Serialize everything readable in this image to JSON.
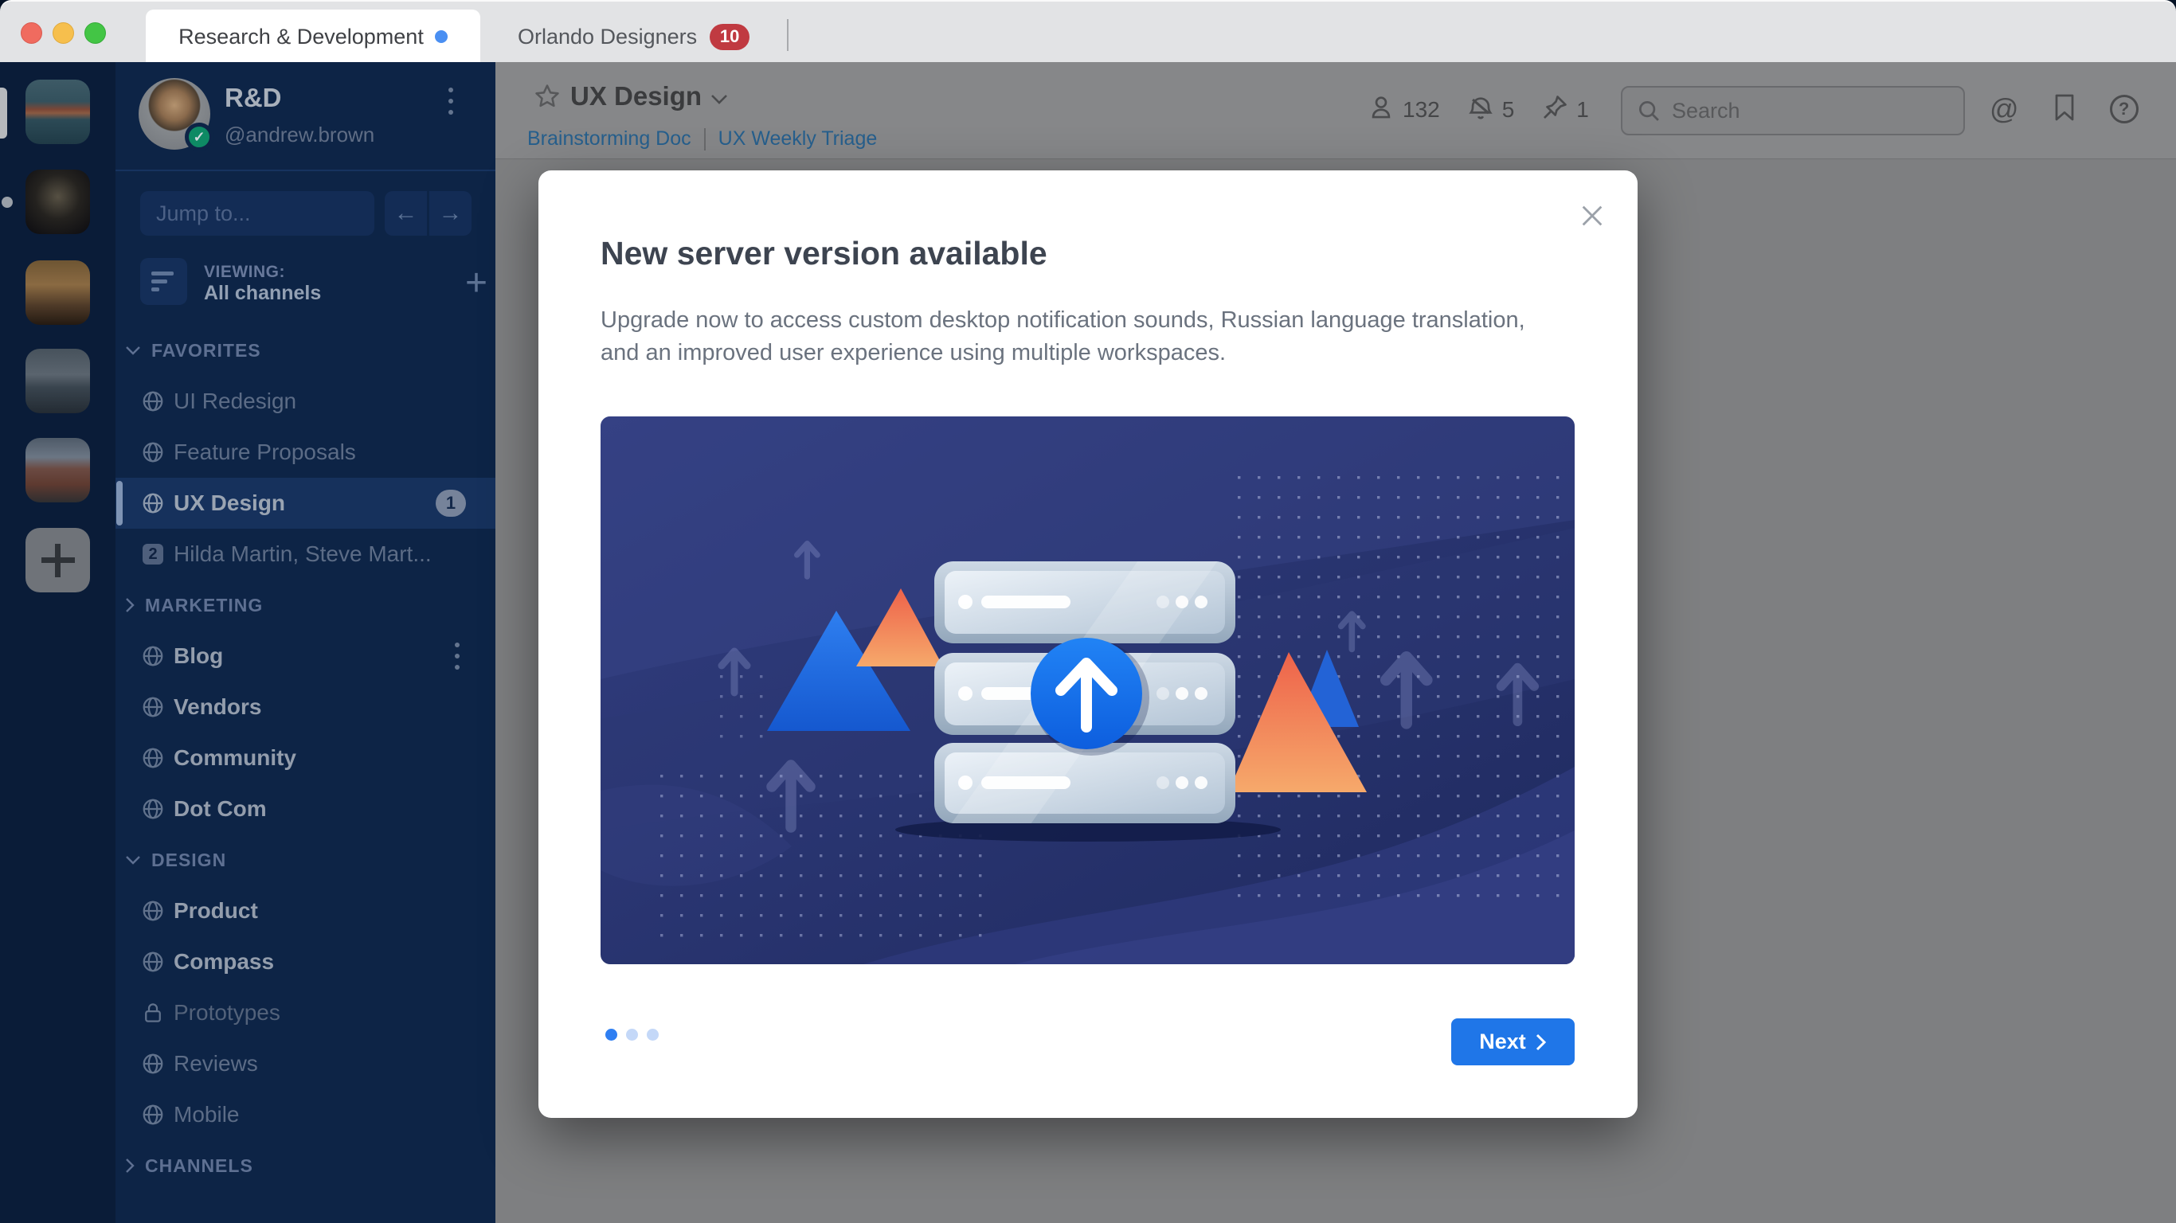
{
  "window": {
    "tabs": [
      {
        "label": "Research & Development",
        "active": true,
        "unread_dot": true
      },
      {
        "label": "Orlando Designers",
        "active": false,
        "badge": "10"
      }
    ]
  },
  "workspace_strip": {
    "avatars": [
      {
        "name": "golden-gate-workspace",
        "gradient": "linear-gradient(180deg,#3d5a66 0%,#33505c 34%,#7a4636 46%,#8a5a42 52%,#2c4a56 62%,#1f3a46 100%)"
      },
      {
        "name": "cathedral-workspace",
        "gradient": "radial-gradient(circle at 50% 42%, #565043 0%, #24221f 45%, #0b0b10 100%)"
      },
      {
        "name": "sunset-city-workspace",
        "gradient": "linear-gradient(180deg,#6e5533 0%,#8a6a42 38%,#4e3a28 70%,#241a12 100%)"
      },
      {
        "name": "city-street-workspace",
        "gradient": "linear-gradient(180deg,#47525c 0%,#5a646e 40%,#39444e 60%,#232b33 100%)"
      },
      {
        "name": "red-building-workspace",
        "gradient": "linear-gradient(180deg,#4e5a68 0%,#6b7684 30%,#6b4a42 48%,#5e3a30 72%,#2e2e30 100%)"
      }
    ],
    "add_label": "+"
  },
  "sidebar": {
    "workspace_name": "R&D",
    "user_handle": "@andrew.brown",
    "jump_placeholder": "Jump to...",
    "viewing_label": "VIEWING:",
    "viewing_value": "All channels",
    "sections": [
      {
        "label": "FAVORITES",
        "collapsed": false,
        "items": [
          {
            "label": "UI Redesign",
            "icon": "globe",
            "state": "read"
          },
          {
            "label": "Feature Proposals",
            "icon": "globe",
            "state": "read"
          },
          {
            "label": "UX Design",
            "icon": "globe",
            "state": "active",
            "badge": "1"
          },
          {
            "label": "Hilda Martin, Steve Mart...",
            "icon": "none",
            "dm_count": "2",
            "state": "read"
          }
        ]
      },
      {
        "label": "MARKETING",
        "collapsed": true,
        "items": [
          {
            "label": "Blog",
            "icon": "globe",
            "state": "unread",
            "kebab": true
          },
          {
            "label": "Vendors",
            "icon": "globe",
            "state": "unread"
          },
          {
            "label": "Community",
            "icon": "globe",
            "state": "unread"
          },
          {
            "label": "Dot Com",
            "icon": "globe",
            "state": "unread"
          }
        ]
      },
      {
        "label": "DESIGN",
        "collapsed": false,
        "items": [
          {
            "label": "Product",
            "icon": "globe",
            "state": "unread"
          },
          {
            "label": "Compass",
            "icon": "globe",
            "state": "unread"
          },
          {
            "label": "Prototypes",
            "icon": "lock",
            "state": "muted"
          },
          {
            "label": "Reviews",
            "icon": "globe",
            "state": "read"
          },
          {
            "label": "Mobile",
            "icon": "globe",
            "state": "read"
          }
        ]
      },
      {
        "label": "CHANNELS",
        "collapsed": true,
        "items": []
      }
    ]
  },
  "header": {
    "channel_title": "UX Design",
    "links": [
      "Brainstorming Doc",
      "UX Weekly Triage"
    ],
    "stats": [
      {
        "icon": "members-icon",
        "value": "132"
      },
      {
        "icon": "snoozed-bell-icon",
        "value": "5"
      },
      {
        "icon": "pin-icon",
        "value": "1"
      }
    ],
    "search_placeholder": "Search"
  },
  "modal": {
    "title": "New server version available",
    "body": "Upgrade now to access custom desktop notification sounds, Russian language translation, and an improved user experience using multiple workspaces.",
    "next_label": "Next",
    "pager": {
      "count": 3,
      "active_index": 0
    },
    "accent_color": "#1f76e8"
  }
}
